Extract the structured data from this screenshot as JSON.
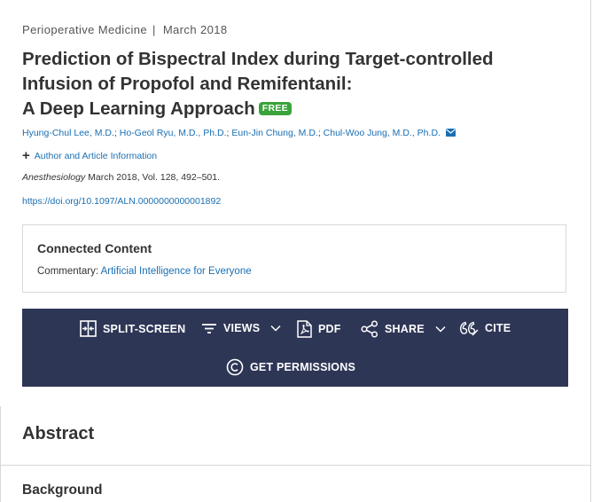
{
  "meta": {
    "category": "Perioperative Medicine",
    "separator": "|",
    "date": "March 2018"
  },
  "article": {
    "title_lines": [
      "Prediction of Bispectral Index during Target-controlled",
      "Infusion of Propofol and Remifentanil:",
      "A Deep Learning Approach"
    ],
    "badge": "FREE",
    "authors": [
      "Hyung-Chul Lee, M.D.",
      "Ho-Geol Ryu, M.D., Ph.D.",
      "Eun-Jin Chung, M.D.",
      "Chul-Woo Jung, M.D., Ph.D."
    ],
    "author_sep": ";",
    "author_info": "Author and Article Information",
    "journal": "Anesthesiology",
    "citation": "March 2018, Vol. 128, 492–501.",
    "doi": "https://doi.org/10.1097/ALN.0000000000001892"
  },
  "connected": {
    "heading": "Connected Content",
    "label": "Commentary:",
    "link": "Artificial Intelligence for Everyone"
  },
  "toolbar": {
    "split_screen": "SPLIT-SCREEN",
    "views": "VIEWS",
    "pdf": "PDF",
    "share": "SHARE",
    "cite": "CITE",
    "permissions": "GET PERMISSIONS"
  },
  "sections": {
    "abstract": "Abstract",
    "background": "Background"
  },
  "colors": {
    "toolbar_bg": "#2e3656",
    "link": "#1a6fb3",
    "badge": "#3aa33a"
  },
  "icons": [
    "plus-icon",
    "mail-icon",
    "split-screen-icon",
    "filter-icon",
    "chevron-down-icon",
    "pdf-icon",
    "share-icon",
    "cite-icon",
    "copyright-icon"
  ]
}
